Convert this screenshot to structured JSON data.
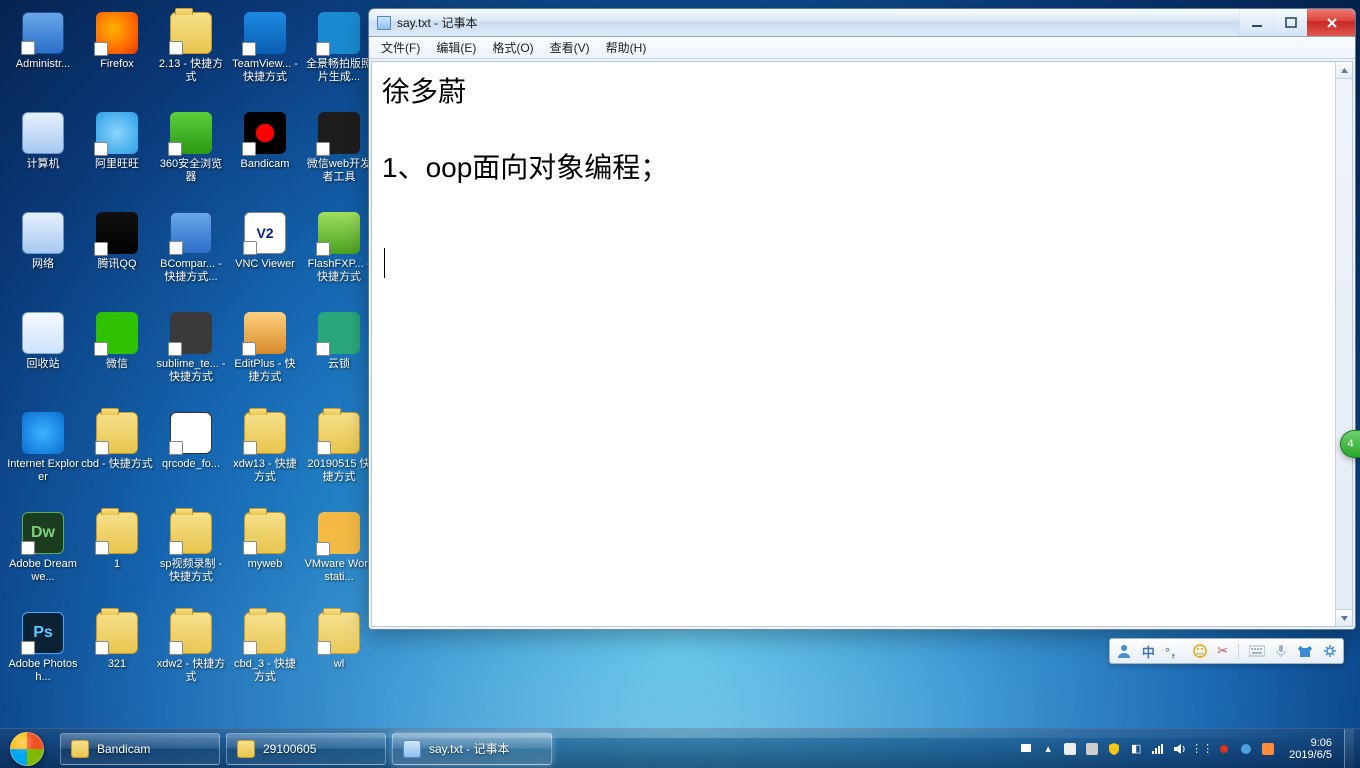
{
  "desktop_icons": [
    {
      "label": "Administr...",
      "kind": "app-generic"
    },
    {
      "label": "Firefox",
      "kind": "firefox"
    },
    {
      "label": "2.13 - 快捷方式",
      "kind": "folder"
    },
    {
      "label": "TeamView... - 快捷方式",
      "kind": "tv"
    },
    {
      "label": "全景畅拍版照片生成...",
      "kind": "pano"
    },
    {
      "label": "计算机",
      "kind": "pcicon"
    },
    {
      "label": "阿里旺旺",
      "kind": "ali"
    },
    {
      "label": "360安全浏览器",
      "kind": "b360"
    },
    {
      "label": "Bandicam",
      "kind": "bandicam"
    },
    {
      "label": "微信web开发者工具",
      "kind": "wx-dev"
    },
    {
      "label": "网络",
      "kind": "net"
    },
    {
      "label": "腾讯QQ",
      "kind": "qq"
    },
    {
      "label": "BCompar... - 快捷方式...",
      "kind": "app-generic"
    },
    {
      "label": "VNC Viewer",
      "kind": "vnc"
    },
    {
      "label": "FlashFXP... - 快捷方式",
      "kind": "flashfxp"
    },
    {
      "label": "回收站",
      "kind": "recycle"
    },
    {
      "label": "微信",
      "kind": "wechat"
    },
    {
      "label": "sublime_te... - 快捷方式",
      "kind": "sublime"
    },
    {
      "label": "EditPlus - 快捷方式",
      "kind": "editplus"
    },
    {
      "label": "云锁",
      "kind": "yun"
    },
    {
      "label": "Internet Explorer",
      "kind": "ie"
    },
    {
      "label": "cbd - 快捷方式",
      "kind": "folder"
    },
    {
      "label": "qrcode_fo...",
      "kind": "qrcode"
    },
    {
      "label": "xdw13 - 快捷方式",
      "kind": "folder"
    },
    {
      "label": "20190515 快捷方式",
      "kind": "folder"
    },
    {
      "label": "Adobe Dreamwe...",
      "kind": "dw"
    },
    {
      "label": "1",
      "kind": "folder"
    },
    {
      "label": "sp视频录制 - 快捷方式",
      "kind": "folder"
    },
    {
      "label": "myweb",
      "kind": "folder"
    },
    {
      "label": "VMware Workstati...",
      "kind": "vm"
    },
    {
      "label": "Adobe Photosh...",
      "kind": "ps"
    },
    {
      "label": "321",
      "kind": "folder"
    },
    {
      "label": "xdw2 - 快捷方式",
      "kind": "folder"
    },
    {
      "label": "cbd_3 - 快捷方式",
      "kind": "folder"
    },
    {
      "label": "wl",
      "kind": "folder"
    }
  ],
  "notepad": {
    "title": "say.txt - 记事本",
    "menu": {
      "file": "文件(F)",
      "edit": "编辑(E)",
      "format": "格式(O)",
      "view": "查看(V)",
      "help": "帮助(H)"
    },
    "lines": {
      "l1": "徐多蔚",
      "l2": "1、oop面向对象编程；"
    }
  },
  "ime": {
    "items": [
      "person",
      "中",
      "punct",
      "smile",
      "scissors",
      "keyboard",
      "mic",
      "shirt",
      "gear"
    ],
    "zh_label": "中"
  },
  "badge_right": "4",
  "taskbar": {
    "buttons": [
      {
        "label": "Bandicam",
        "icon": "tfolder",
        "active": false
      },
      {
        "label": "29100605",
        "icon": "tfolder",
        "active": false
      },
      {
        "label": "say.txt - 记事本",
        "icon": "tnote",
        "active": true
      }
    ],
    "clock": {
      "time": "9:06",
      "date": "2019/6/5"
    }
  }
}
